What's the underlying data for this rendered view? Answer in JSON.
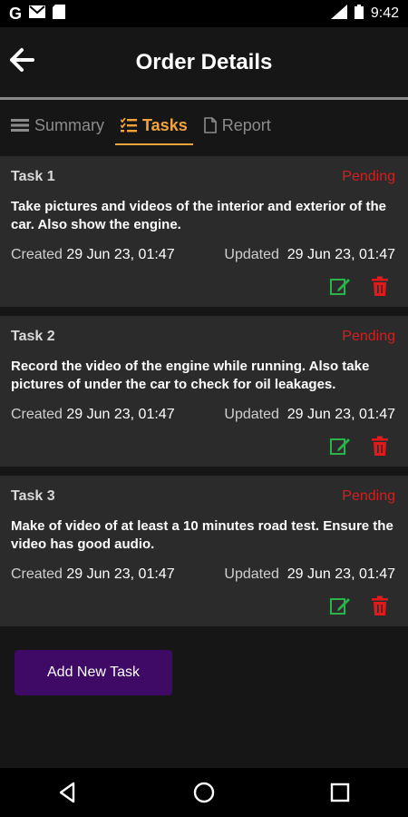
{
  "status_bar": {
    "left_icons": [
      "google-icon",
      "gmail-icon",
      "sd-card-icon"
    ],
    "right_icons": [
      "signal-icon",
      "battery-icon"
    ],
    "time": "9:42"
  },
  "app_bar": {
    "title": "Order Details",
    "back_icon": "arrow-left-icon"
  },
  "tabs": [
    {
      "label": "Summary",
      "icon": "list-lines-icon",
      "active": false
    },
    {
      "label": "Tasks",
      "icon": "checklist-icon",
      "active": true
    },
    {
      "label": "Report",
      "icon": "document-icon",
      "active": false
    }
  ],
  "tasks": [
    {
      "name": "Task 1",
      "status": "Pending",
      "description": "Take pictures and videos of the interior and exterior of the car. Also show the engine.",
      "created_label": "Created",
      "created": "29 Jun 23, 01:47",
      "updated_label": "Updated",
      "updated": "29 Jun 23, 01:47"
    },
    {
      "name": "Task 2",
      "status": "Pending",
      "description": "Record the video of the engine while running. Also take pictures of under the car to check for oil leakages.",
      "created_label": "Created",
      "created": "29 Jun 23, 01:47",
      "updated_label": "Updated",
      "updated": "29 Jun 23, 01:47"
    },
    {
      "name": "Task 3",
      "status": "Pending",
      "description": "Make of video of at least a 10 minutes road test. Ensure the video has good audio.",
      "created_label": "Created",
      "created": "29 Jun 23, 01:47",
      "updated_label": "Updated",
      "updated": "29 Jun 23, 01:47"
    }
  ],
  "add_button": {
    "label": "Add New Task"
  },
  "colors": {
    "accent": "#f2a33a",
    "pending": "#d12020",
    "edit": "#2bb24c",
    "delete": "#e01b1b",
    "button_bg": "#3e0a66",
    "card_bg": "#2b2b2b"
  }
}
